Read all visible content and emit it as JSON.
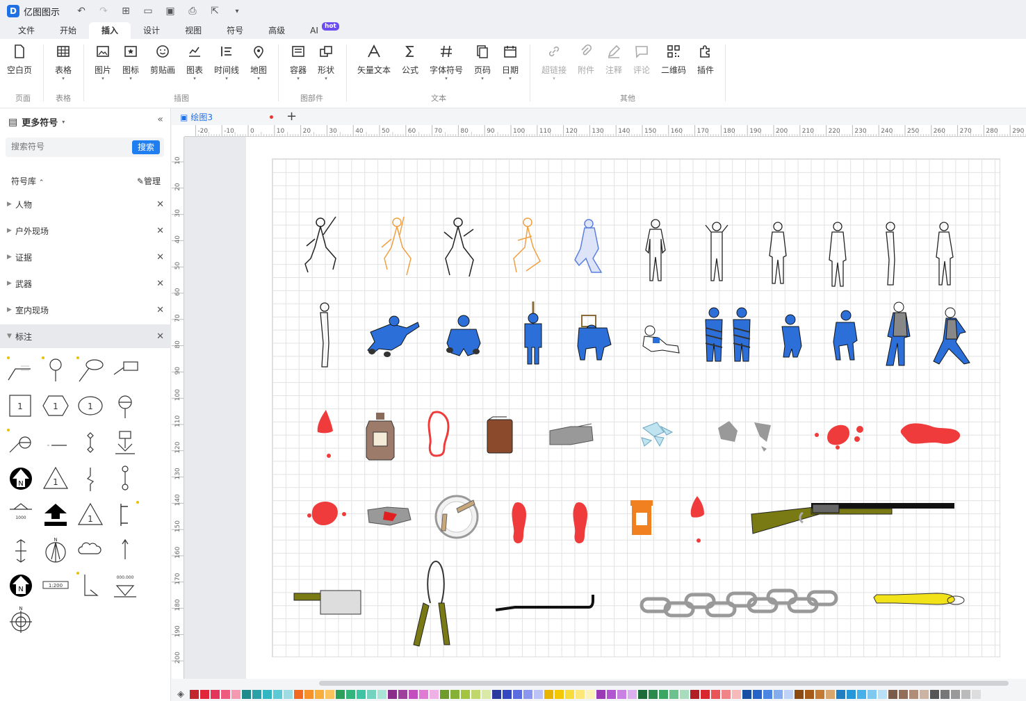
{
  "app": {
    "name": "亿图图示"
  },
  "menu_tabs": [
    {
      "label": "文件"
    },
    {
      "label": "开始"
    },
    {
      "label": "插入",
      "active": true
    },
    {
      "label": "设计"
    },
    {
      "label": "视图"
    },
    {
      "label": "符号"
    },
    {
      "label": "高级"
    },
    {
      "label": "AI",
      "badge": "hot"
    }
  ],
  "ribbon": {
    "buttons": {
      "blank_page": "空白页",
      "table": "表格",
      "picture": "图片",
      "icon": "图标",
      "clipart": "剪贴画",
      "chart": "图表",
      "timeline": "时间线",
      "map": "地图",
      "container": "容器",
      "shape": "形状",
      "vector_text": "矢量文本",
      "formula": "公式",
      "font_symbol": "字体符号",
      "page_number": "页码",
      "date": "日期",
      "hyperlink": "超链接",
      "attachment": "附件",
      "note": "注释",
      "comment": "评论",
      "qrcode": "二维码",
      "plugin": "插件"
    },
    "groups": {
      "page": "页面",
      "table": "表格",
      "illustration": "插图",
      "parts": "图部件",
      "text": "文本",
      "other": "其他"
    }
  },
  "sidebar": {
    "title": "更多符号",
    "search_placeholder": "搜索符号",
    "search_button": "搜索",
    "library_label": "符号库",
    "manage_label": "管理",
    "categories": [
      "人物",
      "户外现场",
      "证据",
      "武器",
      "室内现场",
      "标注"
    ],
    "active_category": "标注",
    "symbols": {
      "box_1": "1",
      "hex_1": "1",
      "oval_1": "1",
      "north": "N",
      "scale": "1:200"
    }
  },
  "document": {
    "tab": "绘图3"
  },
  "ruler": {
    "h_ticks": [
      "-20",
      "-10",
      "0",
      "10",
      "20",
      "30",
      "40",
      "50",
      "60",
      "70",
      "80",
      "90",
      "100",
      "110",
      "120",
      "130",
      "140",
      "150",
      "160",
      "170",
      "180",
      "190",
      "200",
      "210",
      "220",
      "230",
      "240",
      "250",
      "260",
      "270",
      "280",
      "290"
    ],
    "v_ticks": [
      "10",
      "20",
      "30",
      "40",
      "50",
      "60",
      "70",
      "80",
      "90",
      "100",
      "110",
      "120",
      "130",
      "140",
      "150",
      "160",
      "170",
      "180",
      "190",
      "200"
    ]
  },
  "palette": [
    "#c1272d",
    "#e0283a",
    "#e3365a",
    "#ef5b7e",
    "#f49ab0",
    "#1f8a8a",
    "#29a1a7",
    "#32b6c2",
    "#5cc9d4",
    "#9fdbe2",
    "#f26a21",
    "#f7922b",
    "#f9ad3a",
    "#fcc35d",
    "#2ca05a",
    "#31b57a",
    "#3fc4a3",
    "#74d3bf",
    "#a9e4d7",
    "#8a2c8a",
    "#a03e9e",
    "#c24fbd",
    "#e07bd4",
    "#efb0e6",
    "#6e9b2a",
    "#85b135",
    "#a2c43f",
    "#c0d86b",
    "#d9e9a6",
    "#2a3a9e",
    "#3448c2",
    "#5b6be0",
    "#8b96ef",
    "#bcc3f7",
    "#e8b400",
    "#f4c800",
    "#f8dc3a",
    "#fbe878",
    "#fdf3b6",
    "#9a3ab4",
    "#b255d1",
    "#c981e2",
    "#dcb0ee",
    "#1e6b3a",
    "#2a8a4c",
    "#3aa662",
    "#6cc28f",
    "#a8dcbc",
    "#b11f24",
    "#d7262d",
    "#e95458",
    "#f18488",
    "#f8b9bb",
    "#1a4ea3",
    "#2563c9",
    "#4b86e3",
    "#84adef",
    "#bed3f7",
    "#8a4a12",
    "#a55a18",
    "#c37a32",
    "#d9a66e",
    "#1f7fc1",
    "#2596d8",
    "#47b0e8",
    "#7fc9f1",
    "#b8e1f8",
    "#7a5c4a",
    "#936f5a",
    "#b08d76",
    "#cdb3a2",
    "#555555",
    "#777777",
    "#999999",
    "#bbbbbb",
    "#dddddd"
  ]
}
